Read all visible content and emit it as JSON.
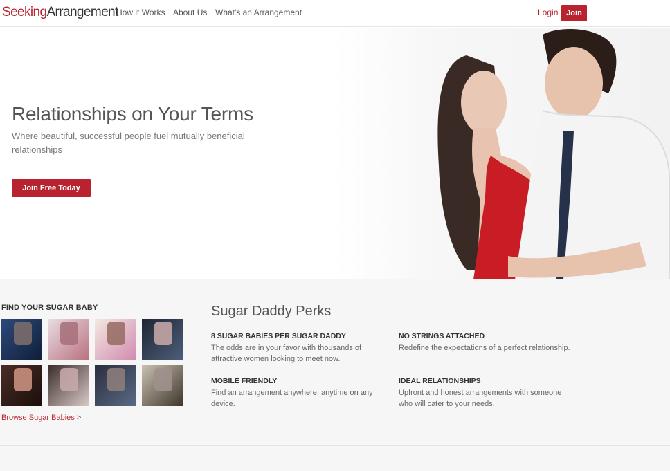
{
  "header": {
    "logo_part1": "Seeking",
    "logo_part2": "Arrangement",
    "nav": [
      "How it Works",
      "About Us",
      "What's an Arrangement"
    ],
    "login": "Login",
    "join": "Join"
  },
  "hero": {
    "title": "Relationships on Your Terms",
    "subtitle": "Where beautiful, successful people fuel mutually beneficial relationships",
    "cta": "Join Free Today"
  },
  "find": {
    "title": "FIND YOUR SUGAR BABY",
    "browse": "Browse Sugar Babies >"
  },
  "perks": {
    "title": "Sugar Daddy Perks",
    "items": [
      {
        "heading": "8 SUGAR BABIES PER SUGAR DADDY",
        "text": "The odds are in your favor with thousands of attractive women looking to meet now."
      },
      {
        "heading": "NO STRINGS ATTACHED",
        "text": "Redefine the expectations of a perfect relationship."
      },
      {
        "heading": "MOBILE FRIENDLY",
        "text": "Find an arrangement anywhere, anytime on any device."
      },
      {
        "heading": "IDEAL RELATIONSHIPS",
        "text": "Upfront and honest arrangements with someone who will cater to your needs."
      }
    ]
  },
  "colors": {
    "brand": "#b8232f",
    "background_lower": "#f6f6f6"
  }
}
